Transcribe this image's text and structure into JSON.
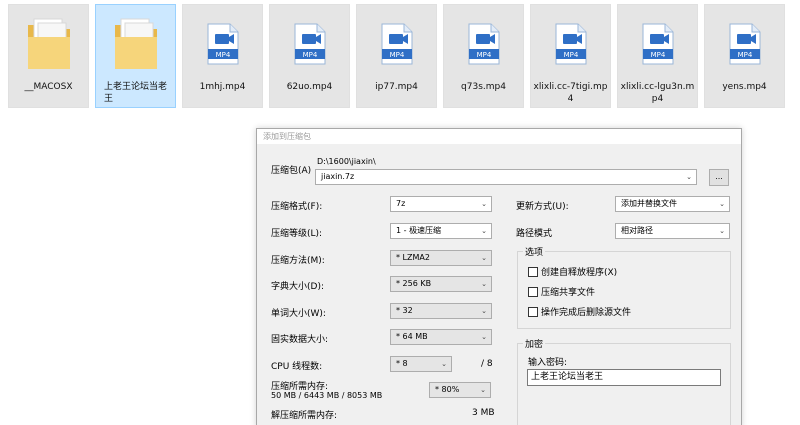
{
  "files": [
    {
      "name": "__MACOSX",
      "type": "folder"
    },
    {
      "name": "上老王论坛当老王",
      "type": "folder",
      "selected": true
    },
    {
      "name": "1mhj.mp4",
      "type": "mp4"
    },
    {
      "name": "62uo.mp4",
      "type": "mp4"
    },
    {
      "name": "ip77.mp4",
      "type": "mp4"
    },
    {
      "name": "q73s.mp4",
      "type": "mp4"
    },
    {
      "name": "xlixli.cc-7tigi.mp4",
      "type": "mp4"
    },
    {
      "name": "xlixli.cc-lgu3n.mp4",
      "type": "mp4"
    },
    {
      "name": "yens.mp4",
      "type": "mp4"
    }
  ],
  "mp4_badge": "MP4",
  "dialog": {
    "title": "添加到压缩包",
    "archive_label": "压缩包(A)",
    "archive_dir": "D:\\1600\\jiaxin\\",
    "archive_name": "jiaxin.7z",
    "browse_label": "...",
    "format_label": "压缩格式(F):",
    "format_value": "7z",
    "level_label": "压缩等级(L):",
    "level_value": "1 - 极速压缩",
    "method_label": "压缩方法(M):",
    "method_value": "* LZMA2",
    "dict_label": "字典大小(D):",
    "dict_value": "* 256 KB",
    "word_label": "单词大小(W):",
    "word_value": "* 32",
    "solid_label": "固实数据大小:",
    "solid_value": "* 64 MB",
    "cpu_label": "CPU 线程数:",
    "cpu_value": "* 8",
    "cpu_total": "/ 8",
    "mem_label": "压缩所需内存:",
    "mem_detail": "50 MB / 6443 MB / 8053 MB",
    "mem_value": "* 80%",
    "decomp_label": "解压缩所需内存:",
    "decomp_value": "3 MB",
    "update_label": "更新方式(U):",
    "update_value": "添加并替换文件",
    "pathmode_label": "路径模式",
    "pathmode_value": "相对路径",
    "options_title": "选项",
    "opt_sfx": "创建自释放程序(X)",
    "opt_shared": "压缩共享文件",
    "opt_delete": "操作完成后删除源文件",
    "enc_title": "加密",
    "password_label": "输入密码:",
    "password_value": "上老王论坛当老王"
  }
}
